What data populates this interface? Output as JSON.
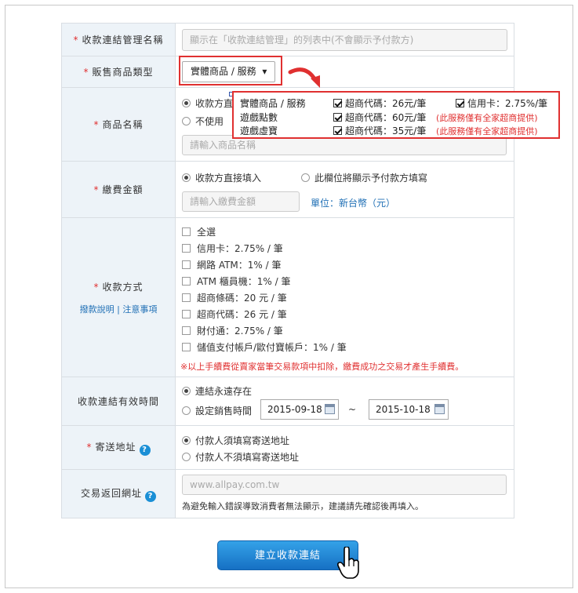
{
  "form": {
    "name_label": "收款連結管理名稱",
    "name_placeholder": "顯示在「收款連結管理」的列表中(不會顯示予付款方)",
    "type_label": "販售商品類型",
    "type_value": "實體商品 / 服務",
    "product_label": "商品名稱",
    "product_opt1": "收款方直",
    "product_opt2": "不使用",
    "product_placeholder": "請輸入商品名稱",
    "amount_label": "繳費金額",
    "amount_opt1": "收款方直接填入",
    "amount_opt2": "此欄位將顯示予付款方填寫",
    "amount_placeholder": "請輸入繳費金額",
    "amount_unit": "單位：新台幣（元）",
    "pay_label": "收款方式",
    "pay_help": "撥款說明",
    "pay_sep": "|",
    "pay_notice": "注意事項",
    "pay_methods": [
      "全選",
      "信用卡：2.75% / 筆",
      "網路 ATM：1% / 筆",
      "ATM 櫃員機：1% / 筆",
      "超商條碼：20 元 / 筆",
      "超商代碼：26 元 / 筆",
      "財付通：2.75% / 筆",
      "儲值支付帳戶/歐付寶帳戶：1% / 筆"
    ],
    "pay_note": "※以上手續費從賣家當筆交易款項中扣除，繳費成功之交易才產生手續費。",
    "valid_label": "收款連結有效時間",
    "valid_opt1": "連結永遠存在",
    "valid_opt2": "設定銷售時間",
    "date_from": "2015-09-18",
    "date_sep": "~",
    "date_to": "2015-10-18",
    "ship_label": "寄送地址",
    "ship_opt1": "付款人須填寫寄送地址",
    "ship_opt2": "付款人不須填寫寄送地址",
    "return_label": "交易返回網址",
    "return_placeholder": "www.allpay.com.tw",
    "return_note": "為避免輸入錯誤導致消費者無法顯示，建議請先確認後再填入。",
    "req_mark": "*",
    "help_mark": "?"
  },
  "popup": {
    "rows": [
      {
        "type": "實體商品 / 服務",
        "opt1": "超商代碼：26元/筆",
        "opt2": "信用卡：2.75%/筆",
        "note": ""
      },
      {
        "type": "遊戲點數",
        "opt1": "超商代碼：60元/筆",
        "opt2": "",
        "note": "(此服務僅有全家超商提供)"
      },
      {
        "type": "遊戲虛寶",
        "opt1": "超商代碼：35元/筆",
        "opt2": "",
        "note": "(此服務僅有全家超商提供)"
      }
    ]
  },
  "submit_label": "建立收款連結",
  "colors": {
    "accent": "#1670c4",
    "highlight": "#e03030",
    "label_bg": "#edf3f8"
  }
}
